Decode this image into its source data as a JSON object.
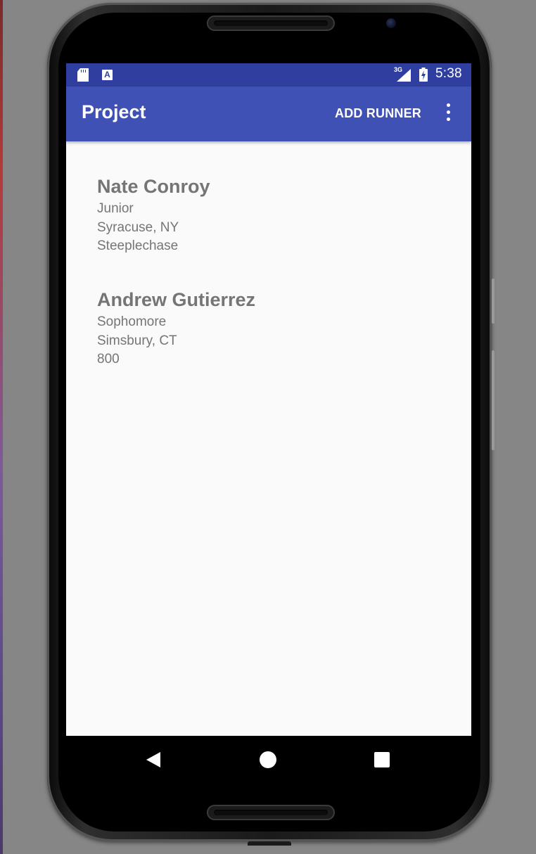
{
  "status_bar": {
    "sd_card_icon": "sd-card-icon",
    "notification_icon": "a-notification-icon",
    "notification_letter": "A",
    "network_type": "3G",
    "signal_icon": "cell-signal-icon",
    "battery_icon": "battery-charging-icon",
    "time": "5:38",
    "color": "#303f9f"
  },
  "app_bar": {
    "title": "Project",
    "action_label": "ADD RUNNER",
    "overflow_icon": "more-vert-icon",
    "color": "#3f51b5"
  },
  "runners": [
    {
      "name": "Nate Conroy",
      "year": "Junior",
      "hometown": "Syracuse, NY",
      "event": "Steeplechase"
    },
    {
      "name": "Andrew Gutierrez",
      "year": "Sophomore",
      "hometown": "Simsbury, CT",
      "event": "800"
    }
  ],
  "nav_bar": {
    "back_icon": "back-triangle-icon",
    "home_icon": "home-circle-icon",
    "recents_icon": "recents-square-icon"
  }
}
